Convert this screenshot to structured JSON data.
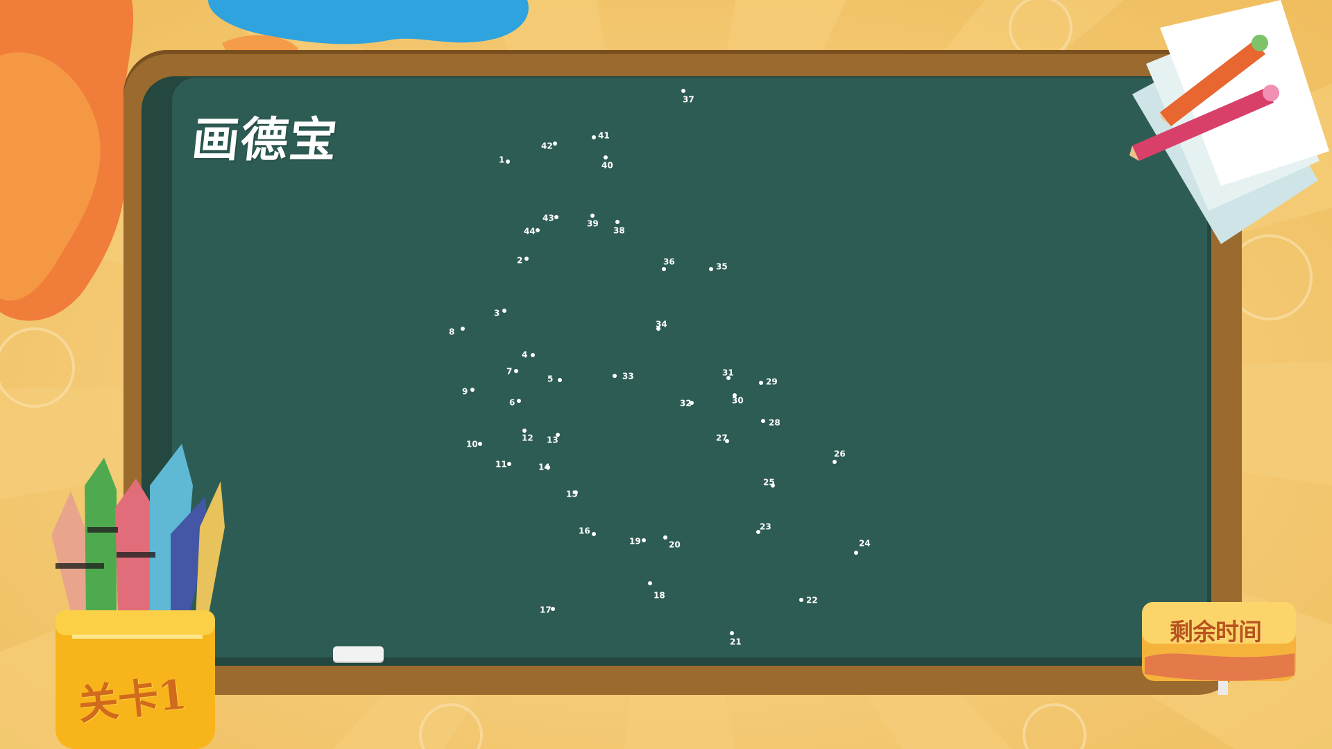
{
  "app": {
    "title": "画德宝"
  },
  "game": {
    "level_label": "关卡1",
    "timer_label": "剩余时间"
  },
  "colors": {
    "background": "#f3c46a",
    "board": "#2d5c54",
    "frame": "#9a6a2e",
    "dot": "#ffffff"
  },
  "puzzle": {
    "points": [
      {
        "n": "1"
      },
      {
        "n": "2"
      },
      {
        "n": "3"
      },
      {
        "n": "4"
      },
      {
        "n": "5"
      },
      {
        "n": "6"
      },
      {
        "n": "7"
      },
      {
        "n": "8"
      },
      {
        "n": "9"
      },
      {
        "n": "10"
      },
      {
        "n": "11"
      },
      {
        "n": "12"
      },
      {
        "n": "13"
      },
      {
        "n": "14"
      },
      {
        "n": "15"
      },
      {
        "n": "16"
      },
      {
        "n": "17"
      },
      {
        "n": "18"
      },
      {
        "n": "19"
      },
      {
        "n": "20"
      },
      {
        "n": "21"
      },
      {
        "n": "22"
      },
      {
        "n": "23"
      },
      {
        "n": "24"
      },
      {
        "n": "25"
      },
      {
        "n": "26"
      },
      {
        "n": "27"
      },
      {
        "n": "28"
      },
      {
        "n": "29"
      },
      {
        "n": "30"
      },
      {
        "n": "31"
      },
      {
        "n": "32"
      },
      {
        "n": "33"
      },
      {
        "n": "34"
      },
      {
        "n": "35"
      },
      {
        "n": "36"
      },
      {
        "n": "37"
      },
      {
        "n": "38"
      },
      {
        "n": "39"
      },
      {
        "n": "40"
      },
      {
        "n": "41"
      },
      {
        "n": "42"
      },
      {
        "n": "43"
      },
      {
        "n": "44"
      }
    ]
  }
}
